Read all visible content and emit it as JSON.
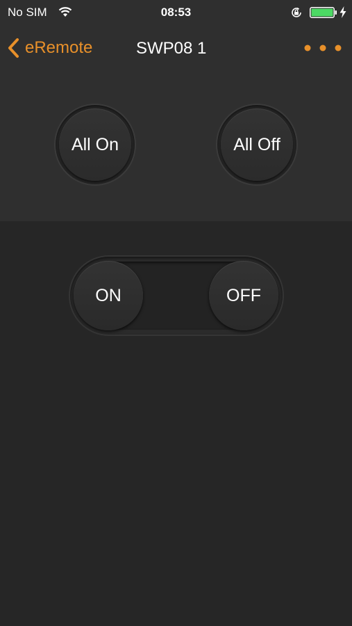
{
  "status_bar": {
    "carrier": "No SIM",
    "time": "08:53",
    "icons": [
      "wifi-icon",
      "orientation-lock-icon",
      "battery-icon",
      "charging-bolt-icon"
    ]
  },
  "nav": {
    "back_label": "eRemote",
    "title": "SWP08 1",
    "more_icon": "more-dots-icon"
  },
  "controls": {
    "all_on_label": "All On",
    "all_off_label": "All Off",
    "on_label": "ON",
    "off_label": "OFF"
  },
  "colors": {
    "accent": "#e8902a",
    "top_panel": "#2f2f2f",
    "background": "#262626",
    "battery_fill": "#4cd964"
  }
}
